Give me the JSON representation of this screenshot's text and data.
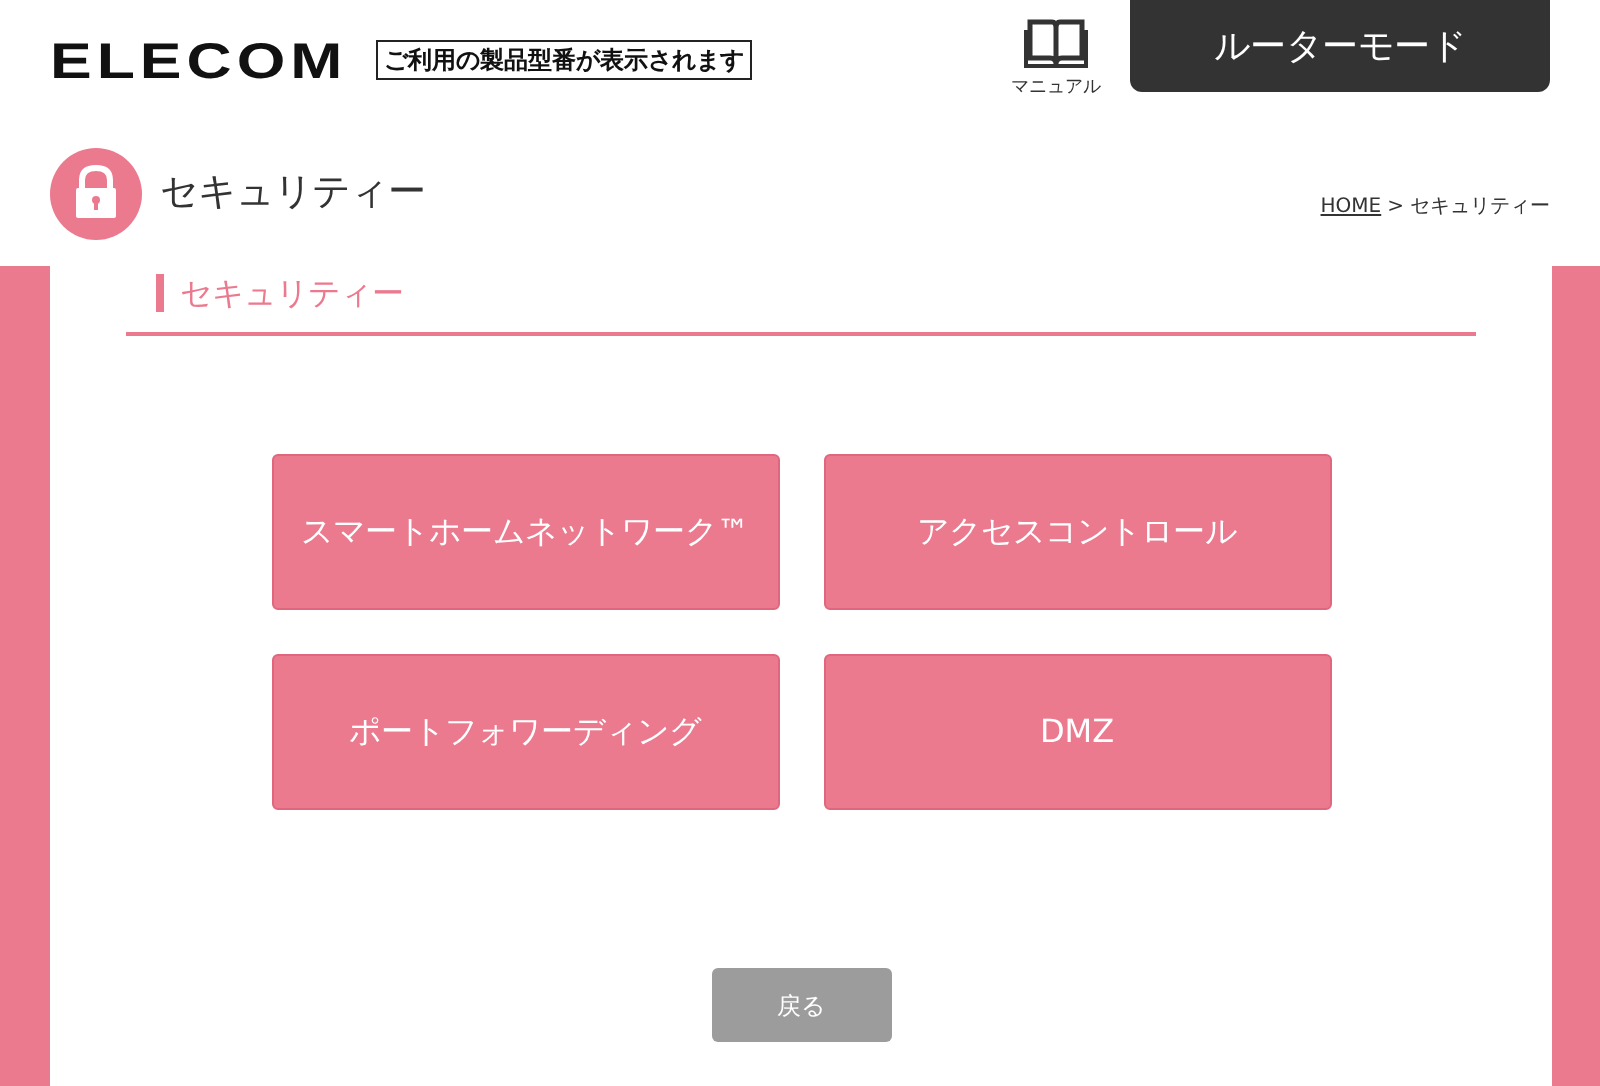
{
  "header": {
    "logo": "ELECOM",
    "model_label": "ご利用の製品型番が表示されます",
    "manual_label": "マニュアル",
    "mode": "ルーターモード"
  },
  "page": {
    "title": "セキュリティー",
    "breadcrumb": {
      "home": "HOME",
      "separator": ">",
      "current": "セキュリティー"
    }
  },
  "section": {
    "heading": "セキュリティー"
  },
  "menu_buttons": [
    {
      "label": "スマートホームネットワーク™"
    },
    {
      "label": "アクセスコントロール"
    },
    {
      "label": "ポートフォワーディング"
    },
    {
      "label": "DMZ"
    }
  ],
  "back_button": "戻る"
}
